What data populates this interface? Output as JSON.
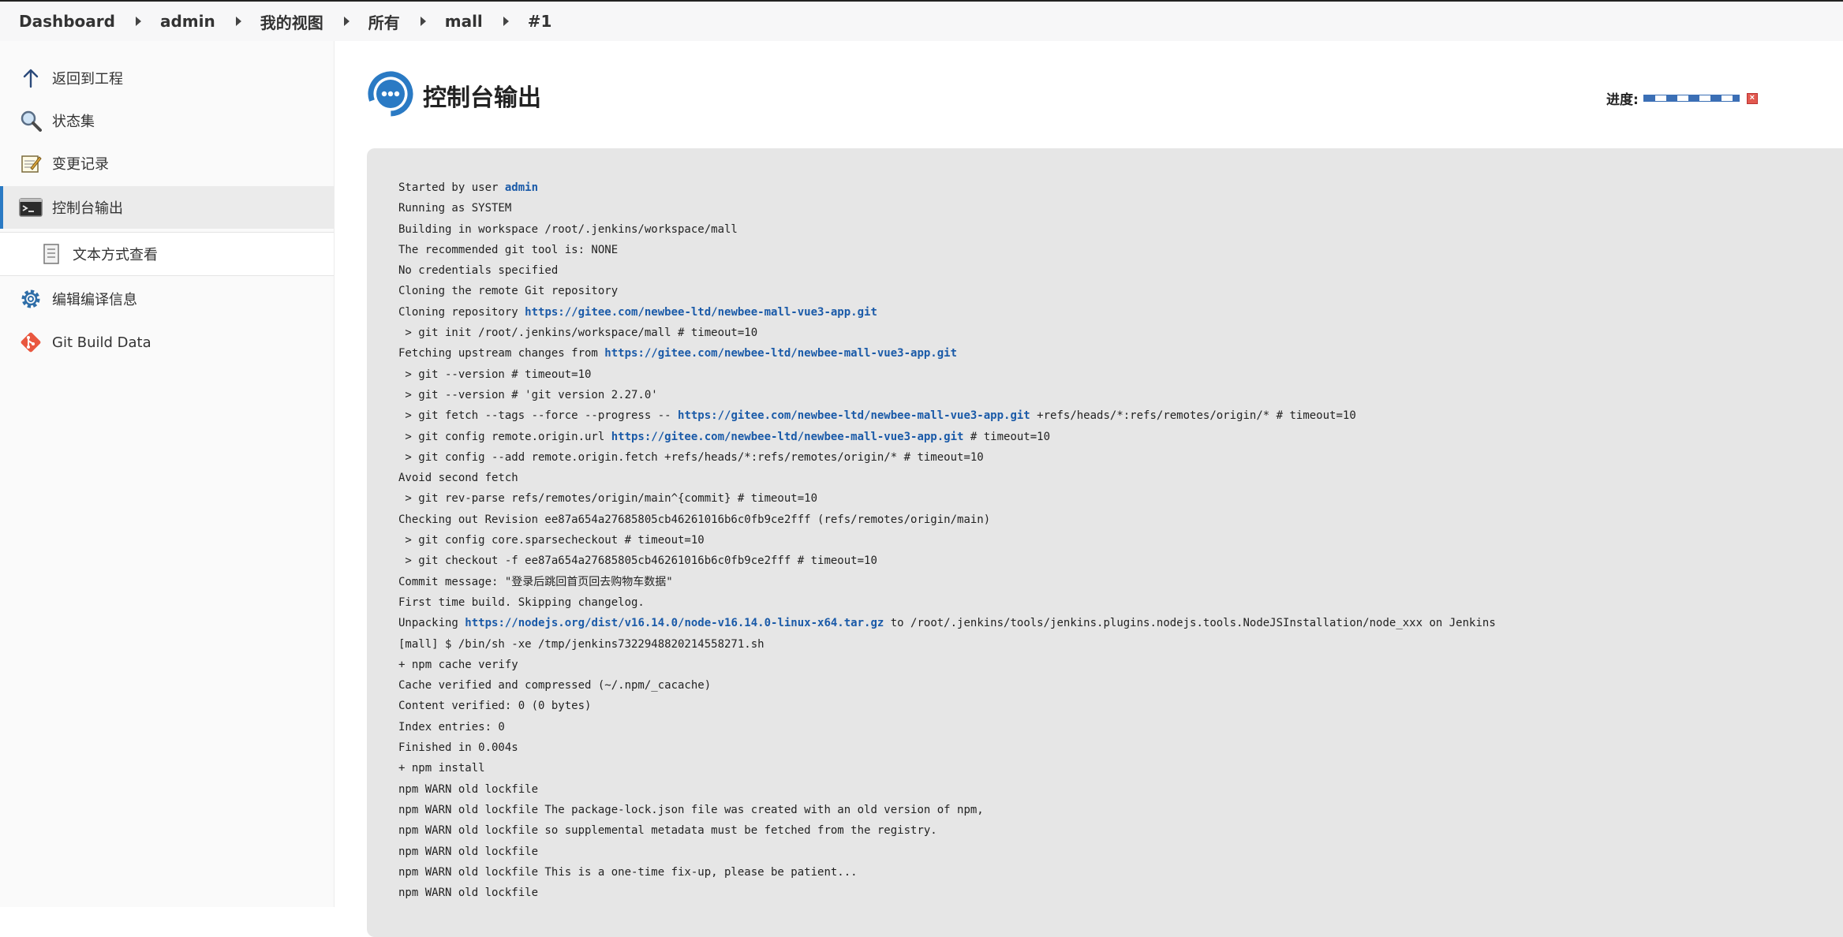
{
  "breadcrumb": {
    "items": [
      "Dashboard",
      "admin",
      "我的视图",
      "所有",
      "mall",
      "#1"
    ]
  },
  "sidebar": {
    "items": [
      {
        "label": "返回到工程",
        "icon": "arrow-up-icon"
      },
      {
        "label": "状态集",
        "icon": "magnifier-icon"
      },
      {
        "label": "变更记录",
        "icon": "notepad-icon"
      },
      {
        "label": "控制台输出",
        "icon": "terminal-icon",
        "active": true
      },
      {
        "label": "文本方式查看",
        "icon": "document-icon"
      },
      {
        "label": "编辑编译信息",
        "icon": "gear-icon"
      },
      {
        "label": "Git Build Data",
        "icon": "git-icon"
      }
    ]
  },
  "main": {
    "title": "控制台输出",
    "progress_label": "进度:"
  },
  "colors": {
    "accent": "#2a7ac4",
    "link": "#1a5aa8",
    "console_bg": "#e6e6e6",
    "git_orange": "#e9573f"
  },
  "console": {
    "lines": [
      [
        {
          "t": "Started by user "
        },
        {
          "t": "admin",
          "link": true
        }
      ],
      [
        {
          "t": "Running as SYSTEM"
        }
      ],
      [
        {
          "t": "Building in workspace /root/.jenkins/workspace/mall"
        }
      ],
      [
        {
          "t": "The recommended git tool is: NONE"
        }
      ],
      [
        {
          "t": "No credentials specified"
        }
      ],
      [
        {
          "t": "Cloning the remote Git repository"
        }
      ],
      [
        {
          "t": "Cloning repository "
        },
        {
          "t": "https://gitee.com/newbee-ltd/newbee-mall-vue3-app.git",
          "link": true
        }
      ],
      [
        {
          "t": " > git init /root/.jenkins/workspace/mall # timeout=10"
        }
      ],
      [
        {
          "t": "Fetching upstream changes from "
        },
        {
          "t": "https://gitee.com/newbee-ltd/newbee-mall-vue3-app.git",
          "link": true
        }
      ],
      [
        {
          "t": " > git --version # timeout=10"
        }
      ],
      [
        {
          "t": " > git --version # 'git version 2.27.0'"
        }
      ],
      [
        {
          "t": " > git fetch --tags --force --progress -- "
        },
        {
          "t": "https://gitee.com/newbee-ltd/newbee-mall-vue3-app.git",
          "link": true
        },
        {
          "t": " +refs/heads/*:refs/remotes/origin/* # timeout=10"
        }
      ],
      [
        {
          "t": " > git config remote.origin.url "
        },
        {
          "t": "https://gitee.com/newbee-ltd/newbee-mall-vue3-app.git",
          "link": true
        },
        {
          "t": " # timeout=10"
        }
      ],
      [
        {
          "t": " > git config --add remote.origin.fetch +refs/heads/*:refs/remotes/origin/* # timeout=10"
        }
      ],
      [
        {
          "t": "Avoid second fetch"
        }
      ],
      [
        {
          "t": " > git rev-parse refs/remotes/origin/main^{commit} # timeout=10"
        }
      ],
      [
        {
          "t": "Checking out Revision ee87a654a27685805cb46261016b6c0fb9ce2fff (refs/remotes/origin/main)"
        }
      ],
      [
        {
          "t": " > git config core.sparsecheckout # timeout=10"
        }
      ],
      [
        {
          "t": " > git checkout -f ee87a654a27685805cb46261016b6c0fb9ce2fff # timeout=10"
        }
      ],
      [
        {
          "t": "Commit message: \"登录后跳回首页回去购物车数据\""
        }
      ],
      [
        {
          "t": "First time build. Skipping changelog."
        }
      ],
      [
        {
          "t": "Unpacking "
        },
        {
          "t": "https://nodejs.org/dist/v16.14.0/node-v16.14.0-linux-x64.tar.gz",
          "link": true
        },
        {
          "t": " to /root/.jenkins/tools/jenkins.plugins.nodejs.tools.NodeJSInstallation/node_xxx on Jenkins"
        }
      ],
      [
        {
          "t": "[mall] $ /bin/sh -xe /tmp/jenkins7322948820214558271.sh"
        }
      ],
      [
        {
          "t": "+ npm cache verify"
        }
      ],
      [
        {
          "t": "Cache verified and compressed (~/.npm/_cacache)"
        }
      ],
      [
        {
          "t": "Content verified: 0 (0 bytes)"
        }
      ],
      [
        {
          "t": "Index entries: 0"
        }
      ],
      [
        {
          "t": "Finished in 0.004s"
        }
      ],
      [
        {
          "t": "+ npm install"
        }
      ],
      [
        {
          "t": "npm WARN old lockfile"
        }
      ],
      [
        {
          "t": "npm WARN old lockfile The package-lock.json file was created with an old version of npm,"
        }
      ],
      [
        {
          "t": "npm WARN old lockfile so supplemental metadata must be fetched from the registry."
        }
      ],
      [
        {
          "t": "npm WARN old lockfile"
        }
      ],
      [
        {
          "t": "npm WARN old lockfile This is a one-time fix-up, please be patient..."
        }
      ],
      [
        {
          "t": "npm WARN old lockfile"
        }
      ]
    ]
  }
}
